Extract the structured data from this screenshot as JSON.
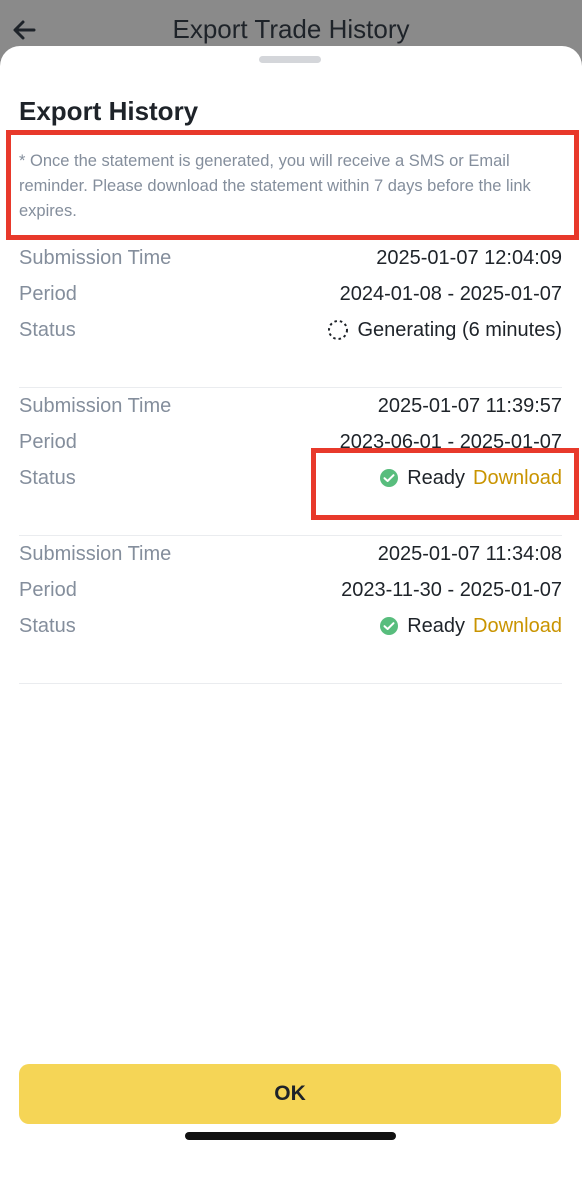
{
  "header": {
    "title": "Export Trade History",
    "back_icon": "arrow-left-icon"
  },
  "sheet": {
    "title": "Export History",
    "notice": "* Once the statement is generated, you will receive a SMS or Email reminder. Please download the statement within 7 days before the link expires."
  },
  "labels": {
    "submission_time": "Submission Time",
    "period": "Period",
    "status": "Status"
  },
  "records": [
    {
      "submission_time": "2025-01-07 12:04:09",
      "period": "2024-01-08 - 2025-01-07",
      "status": "Generating (6 minutes)",
      "status_icon": "spinner-icon"
    },
    {
      "submission_time": "2025-01-07 11:39:57",
      "period": "2023-06-01 - 2025-01-07",
      "status": "Ready",
      "status_icon": "check-circle-icon",
      "action": "Download"
    },
    {
      "submission_time": "2025-01-07 11:34:08",
      "period": "2023-11-30 - 2025-01-07",
      "status": "Ready",
      "status_icon": "check-circle-icon",
      "action": "Download"
    }
  ],
  "footer": {
    "ok_label": "OK"
  },
  "colors": {
    "accent": "#F5D556",
    "link": "#C99400",
    "success": "#58BD7D",
    "highlight": "#E8392B"
  }
}
